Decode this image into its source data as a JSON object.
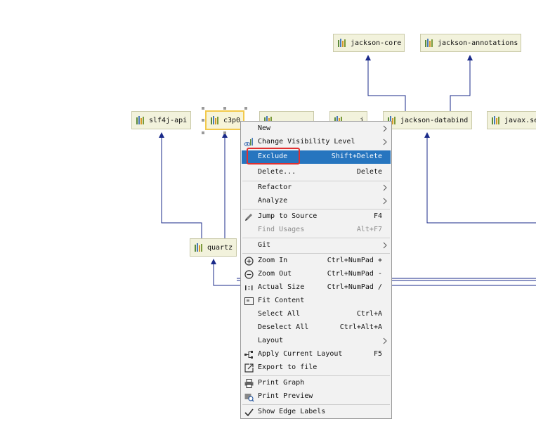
{
  "graph": {
    "nodes": [
      {
        "id": "jackson-core",
        "label": "jackson-core"
      },
      {
        "id": "jackson-annotations",
        "label": "jackson-annotations"
      },
      {
        "id": "slf4j-api",
        "label": "slf4j-api"
      },
      {
        "id": "c3p0",
        "label": "c3p0"
      },
      {
        "id": "hidden-1",
        "label": ""
      },
      {
        "id": "hidden-2",
        "label": "...j"
      },
      {
        "id": "jackson-databind",
        "label": "jackson-databind"
      },
      {
        "id": "javax",
        "label": "javax.se"
      },
      {
        "id": "quartz",
        "label": "quartz"
      }
    ]
  },
  "context_menu": {
    "items": [
      {
        "id": "new",
        "label": "New",
        "shortcut": "",
        "submenu": true,
        "icon": ""
      },
      {
        "id": "change-visibility-level",
        "label": "Change Visibility Level",
        "shortcut": "",
        "submenu": true,
        "icon": "eye-bars-icon"
      },
      {
        "id": "exclude",
        "label": "Exclude",
        "shortcut": "Shift+Delete",
        "submenu": false,
        "icon": "",
        "highlight": true
      },
      {
        "id": "delete",
        "label": "Delete...",
        "shortcut": "Delete",
        "submenu": false,
        "icon": ""
      },
      {
        "id": "refactor",
        "label": "Refactor",
        "shortcut": "",
        "submenu": true,
        "icon": ""
      },
      {
        "id": "analyze",
        "label": "Analyze",
        "shortcut": "",
        "submenu": true,
        "icon": ""
      },
      {
        "id": "jump-to-source",
        "label": "Jump to Source",
        "shortcut": "F4",
        "submenu": false,
        "icon": "pencil-icon"
      },
      {
        "id": "find-usages",
        "label": "Find Usages",
        "shortcut": "Alt+F7",
        "submenu": false,
        "icon": "",
        "disabled": true
      },
      {
        "id": "git",
        "label": "Git",
        "shortcut": "",
        "submenu": true,
        "icon": ""
      },
      {
        "id": "zoom-in",
        "label": "Zoom In",
        "shortcut": "Ctrl+NumPad +",
        "submenu": false,
        "icon": "zoom-in-icon"
      },
      {
        "id": "zoom-out",
        "label": "Zoom Out",
        "shortcut": "Ctrl+NumPad -",
        "submenu": false,
        "icon": "zoom-out-icon"
      },
      {
        "id": "actual-size",
        "label": "Actual Size",
        "shortcut": "Ctrl+NumPad /",
        "submenu": false,
        "icon": "actual-size-icon"
      },
      {
        "id": "fit-content",
        "label": "Fit Content",
        "shortcut": "",
        "submenu": false,
        "icon": "fit-content-icon"
      },
      {
        "id": "select-all",
        "label": "Select All",
        "shortcut": "Ctrl+A",
        "submenu": false,
        "icon": ""
      },
      {
        "id": "deselect-all",
        "label": "Deselect All",
        "shortcut": "Ctrl+Alt+A",
        "submenu": false,
        "icon": ""
      },
      {
        "id": "layout",
        "label": "Layout",
        "shortcut": "",
        "submenu": true,
        "icon": ""
      },
      {
        "id": "apply-current-layout",
        "label": "Apply Current Layout",
        "shortcut": "F5",
        "submenu": false,
        "icon": "layout-tree-icon"
      },
      {
        "id": "export-to-file",
        "label": "Export to file",
        "shortcut": "",
        "submenu": false,
        "icon": "export-icon"
      },
      {
        "id": "print-graph",
        "label": "Print Graph",
        "shortcut": "",
        "submenu": false,
        "icon": "printer-icon"
      },
      {
        "id": "print-preview",
        "label": "Print Preview",
        "shortcut": "",
        "submenu": false,
        "icon": "print-preview-icon"
      },
      {
        "id": "show-edge-labels",
        "label": "Show Edge Labels",
        "shortcut": "",
        "submenu": false,
        "icon": "checkmark-icon"
      }
    ]
  },
  "colors": {
    "edge": "#1a2a8a",
    "menu_highlight": "#2675bf",
    "annotation_red": "#e03030",
    "node_fill": "#f2f2dc"
  }
}
